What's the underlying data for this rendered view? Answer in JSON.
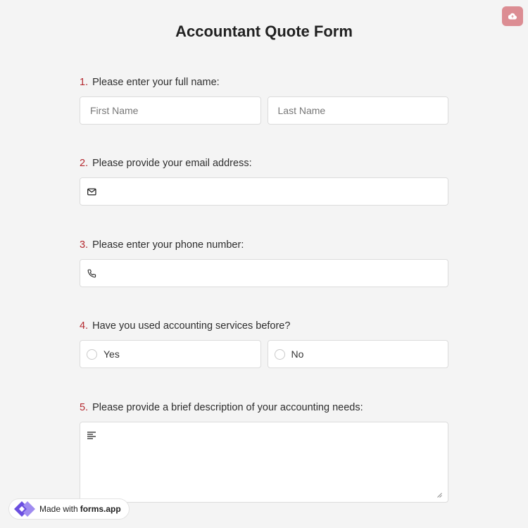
{
  "form": {
    "title": "Accountant Quote Form"
  },
  "questions": [
    {
      "number": "1.",
      "label": "Please enter your full name:",
      "first_placeholder": "First Name",
      "last_placeholder": "Last Name"
    },
    {
      "number": "2.",
      "label": "Please provide your email address:",
      "icon": "envelope-icon"
    },
    {
      "number": "3.",
      "label": "Please enter your phone number:",
      "icon": "phone-icon"
    },
    {
      "number": "4.",
      "label": "Have you used accounting services before?",
      "options": [
        "Yes",
        "No"
      ]
    },
    {
      "number": "5.",
      "label": "Please provide a brief description of your accounting needs:",
      "icon": "text-align-icon"
    }
  ],
  "header": {
    "save_icon": "cloud-upload-icon"
  },
  "badge": {
    "made_with": "Made with",
    "brand": "forms.app"
  },
  "colors": {
    "background": "#f4f4f4",
    "number_accent": "#b4292f",
    "save_button": "#dc8d93",
    "field_border": "#dcdcdc",
    "logo_purple": "#6b4fe0"
  }
}
